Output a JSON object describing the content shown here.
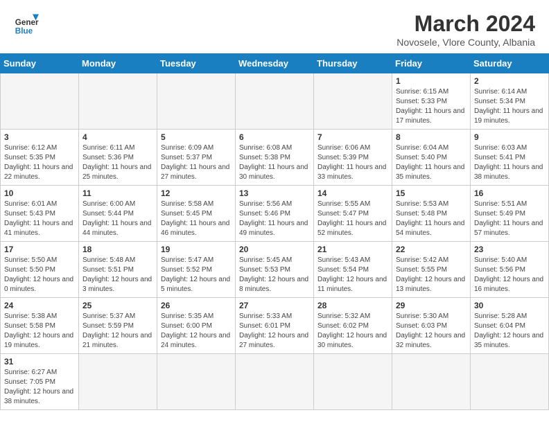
{
  "header": {
    "logo_general": "General",
    "logo_blue": "Blue",
    "month_year": "March 2024",
    "location": "Novosele, Vlore County, Albania"
  },
  "weekdays": [
    "Sunday",
    "Monday",
    "Tuesday",
    "Wednesday",
    "Thursday",
    "Friday",
    "Saturday"
  ],
  "weeks": [
    [
      {
        "day": "",
        "info": ""
      },
      {
        "day": "",
        "info": ""
      },
      {
        "day": "",
        "info": ""
      },
      {
        "day": "",
        "info": ""
      },
      {
        "day": "",
        "info": ""
      },
      {
        "day": "1",
        "info": "Sunrise: 6:15 AM\nSunset: 5:33 PM\nDaylight: 11 hours and 17 minutes."
      },
      {
        "day": "2",
        "info": "Sunrise: 6:14 AM\nSunset: 5:34 PM\nDaylight: 11 hours and 19 minutes."
      }
    ],
    [
      {
        "day": "3",
        "info": "Sunrise: 6:12 AM\nSunset: 5:35 PM\nDaylight: 11 hours and 22 minutes."
      },
      {
        "day": "4",
        "info": "Sunrise: 6:11 AM\nSunset: 5:36 PM\nDaylight: 11 hours and 25 minutes."
      },
      {
        "day": "5",
        "info": "Sunrise: 6:09 AM\nSunset: 5:37 PM\nDaylight: 11 hours and 27 minutes."
      },
      {
        "day": "6",
        "info": "Sunrise: 6:08 AM\nSunset: 5:38 PM\nDaylight: 11 hours and 30 minutes."
      },
      {
        "day": "7",
        "info": "Sunrise: 6:06 AM\nSunset: 5:39 PM\nDaylight: 11 hours and 33 minutes."
      },
      {
        "day": "8",
        "info": "Sunrise: 6:04 AM\nSunset: 5:40 PM\nDaylight: 11 hours and 35 minutes."
      },
      {
        "day": "9",
        "info": "Sunrise: 6:03 AM\nSunset: 5:41 PM\nDaylight: 11 hours and 38 minutes."
      }
    ],
    [
      {
        "day": "10",
        "info": "Sunrise: 6:01 AM\nSunset: 5:43 PM\nDaylight: 11 hours and 41 minutes."
      },
      {
        "day": "11",
        "info": "Sunrise: 6:00 AM\nSunset: 5:44 PM\nDaylight: 11 hours and 44 minutes."
      },
      {
        "day": "12",
        "info": "Sunrise: 5:58 AM\nSunset: 5:45 PM\nDaylight: 11 hours and 46 minutes."
      },
      {
        "day": "13",
        "info": "Sunrise: 5:56 AM\nSunset: 5:46 PM\nDaylight: 11 hours and 49 minutes."
      },
      {
        "day": "14",
        "info": "Sunrise: 5:55 AM\nSunset: 5:47 PM\nDaylight: 11 hours and 52 minutes."
      },
      {
        "day": "15",
        "info": "Sunrise: 5:53 AM\nSunset: 5:48 PM\nDaylight: 11 hours and 54 minutes."
      },
      {
        "day": "16",
        "info": "Sunrise: 5:51 AM\nSunset: 5:49 PM\nDaylight: 11 hours and 57 minutes."
      }
    ],
    [
      {
        "day": "17",
        "info": "Sunrise: 5:50 AM\nSunset: 5:50 PM\nDaylight: 12 hours and 0 minutes."
      },
      {
        "day": "18",
        "info": "Sunrise: 5:48 AM\nSunset: 5:51 PM\nDaylight: 12 hours and 3 minutes."
      },
      {
        "day": "19",
        "info": "Sunrise: 5:47 AM\nSunset: 5:52 PM\nDaylight: 12 hours and 5 minutes."
      },
      {
        "day": "20",
        "info": "Sunrise: 5:45 AM\nSunset: 5:53 PM\nDaylight: 12 hours and 8 minutes."
      },
      {
        "day": "21",
        "info": "Sunrise: 5:43 AM\nSunset: 5:54 PM\nDaylight: 12 hours and 11 minutes."
      },
      {
        "day": "22",
        "info": "Sunrise: 5:42 AM\nSunset: 5:55 PM\nDaylight: 12 hours and 13 minutes."
      },
      {
        "day": "23",
        "info": "Sunrise: 5:40 AM\nSunset: 5:56 PM\nDaylight: 12 hours and 16 minutes."
      }
    ],
    [
      {
        "day": "24",
        "info": "Sunrise: 5:38 AM\nSunset: 5:58 PM\nDaylight: 12 hours and 19 minutes."
      },
      {
        "day": "25",
        "info": "Sunrise: 5:37 AM\nSunset: 5:59 PM\nDaylight: 12 hours and 21 minutes."
      },
      {
        "day": "26",
        "info": "Sunrise: 5:35 AM\nSunset: 6:00 PM\nDaylight: 12 hours and 24 minutes."
      },
      {
        "day": "27",
        "info": "Sunrise: 5:33 AM\nSunset: 6:01 PM\nDaylight: 12 hours and 27 minutes."
      },
      {
        "day": "28",
        "info": "Sunrise: 5:32 AM\nSunset: 6:02 PM\nDaylight: 12 hours and 30 minutes."
      },
      {
        "day": "29",
        "info": "Sunrise: 5:30 AM\nSunset: 6:03 PM\nDaylight: 12 hours and 32 minutes."
      },
      {
        "day": "30",
        "info": "Sunrise: 5:28 AM\nSunset: 6:04 PM\nDaylight: 12 hours and 35 minutes."
      }
    ],
    [
      {
        "day": "31",
        "info": "Sunrise: 6:27 AM\nSunset: 7:05 PM\nDaylight: 12 hours and 38 minutes."
      },
      {
        "day": "",
        "info": ""
      },
      {
        "day": "",
        "info": ""
      },
      {
        "day": "",
        "info": ""
      },
      {
        "day": "",
        "info": ""
      },
      {
        "day": "",
        "info": ""
      },
      {
        "day": "",
        "info": ""
      }
    ]
  ]
}
